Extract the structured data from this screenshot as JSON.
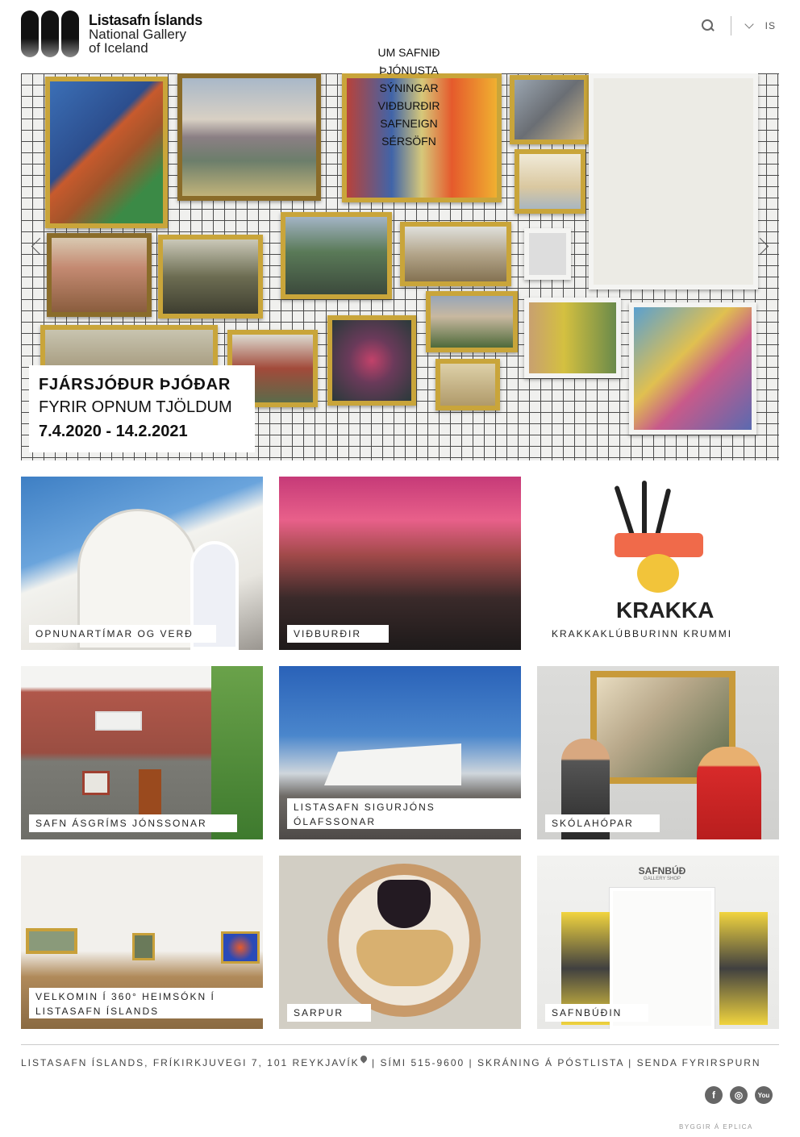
{
  "header": {
    "logo_title": "Listasafn Íslands",
    "logo_sub1": "National Gallery",
    "logo_sub2": "of Iceland",
    "nav": [
      "UM SAFNIÐ",
      "ÞJÓNUSTA",
      "SÝNINGAR",
      "VIÐBURÐIR",
      "SAFNEIGN",
      "SÉRSÖFN"
    ],
    "lang": "IS"
  },
  "hero": {
    "title": "FJÁRSJÓÐUR ÞJÓÐAR",
    "subtitle": "FYRIR OPNUM TJÖLDUM",
    "dates": "7.4.2020 - 14.2.2021"
  },
  "tiles": [
    {
      "label": "OPNUNARTÍMAR OG VERÐ"
    },
    {
      "label": "VIÐBURÐIR"
    },
    {
      "label": "KRAKKAKLÚBBURINN KRUMMI",
      "logo_text": "KRAKKA"
    },
    {
      "label": "SAFN ÁSGRÍMS JÓNSSONAR"
    },
    {
      "label_line1": "LISTASAFN SIGURJÓNS",
      "label_line2": "ÓLAFSSONAR"
    },
    {
      "label": "SKÓLAHÓPAR"
    },
    {
      "label_line1": "VELKOMIN Í 360° HEIMSÓKN Í",
      "label_line2": "LISTASAFN ÍSLANDS"
    },
    {
      "label": "SARPUR"
    },
    {
      "label": "SAFNBÚÐIN",
      "sign": "SAFNBÚÐ",
      "sign_sub": "GALLERY SHOP"
    }
  ],
  "footer": {
    "address": "LISTASAFN ÍSLANDS, FRÍKIRKJUVEGI 7, 101 REYKJAVÍK",
    "phone": "| SÍMI 515-9600",
    "mailing": "| SKRÁNING Á PÓSTLISTA",
    "contact": "| SENDA FYRIRSPURN",
    "socials": [
      "facebook-icon",
      "instagram-icon",
      "youtube-icon"
    ],
    "builder": "BYGGIR Á EPLICA"
  }
}
